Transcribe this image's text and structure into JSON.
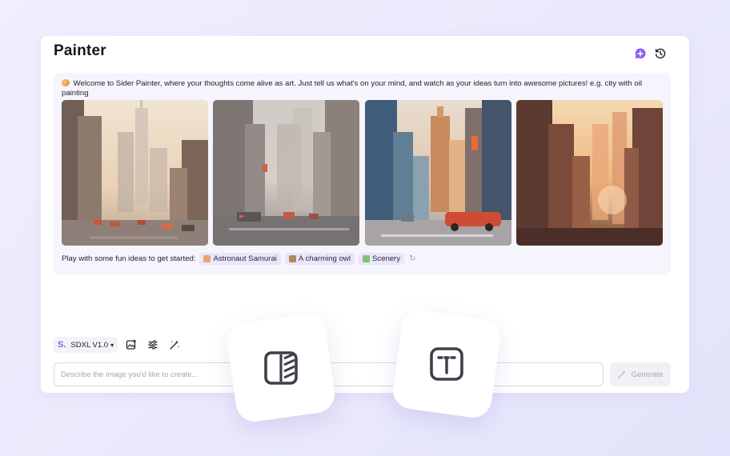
{
  "app": {
    "title": "Painter"
  },
  "header": {
    "icons": [
      "add-chat-icon",
      "history-icon"
    ],
    "accent_color": "#8d5cf5"
  },
  "welcome": {
    "text": "Welcome to Sider Painter, where your thoughts come alive as art. Just tell us what's on your mind, and watch as your ideas turn into awesome pictures! e.g. city with oil painting"
  },
  "gallery": {
    "images": [
      {
        "name": "city-oil-painting-1"
      },
      {
        "name": "city-oil-painting-2"
      },
      {
        "name": "city-oil-painting-3"
      },
      {
        "name": "city-oil-painting-4"
      }
    ]
  },
  "ideas": {
    "label": "Play with some fun ideas to get started:",
    "chips": [
      {
        "label": "Astronaut Samurai",
        "icon": "samurai-icon",
        "color": "#e9a46b"
      },
      {
        "label": "A charming owl",
        "icon": "owl-icon",
        "color": "#b08a5a"
      },
      {
        "label": "Scenery",
        "icon": "scenery-icon",
        "color": "#7fbf7a"
      }
    ],
    "refresh_icon": "refresh-icon"
  },
  "toolbar": {
    "model_prefix": "S.",
    "model_label": "SDXL V1.0",
    "tools": [
      "image-upload-icon",
      "settings-sliders-icon",
      "magic-wand-icon"
    ]
  },
  "prompt": {
    "placeholder": "Describe the image you'd like to create...",
    "value": ""
  },
  "generate": {
    "label": "Generate"
  },
  "floating": {
    "icons": [
      "background-remover-icon",
      "text-to-image-icon"
    ]
  }
}
